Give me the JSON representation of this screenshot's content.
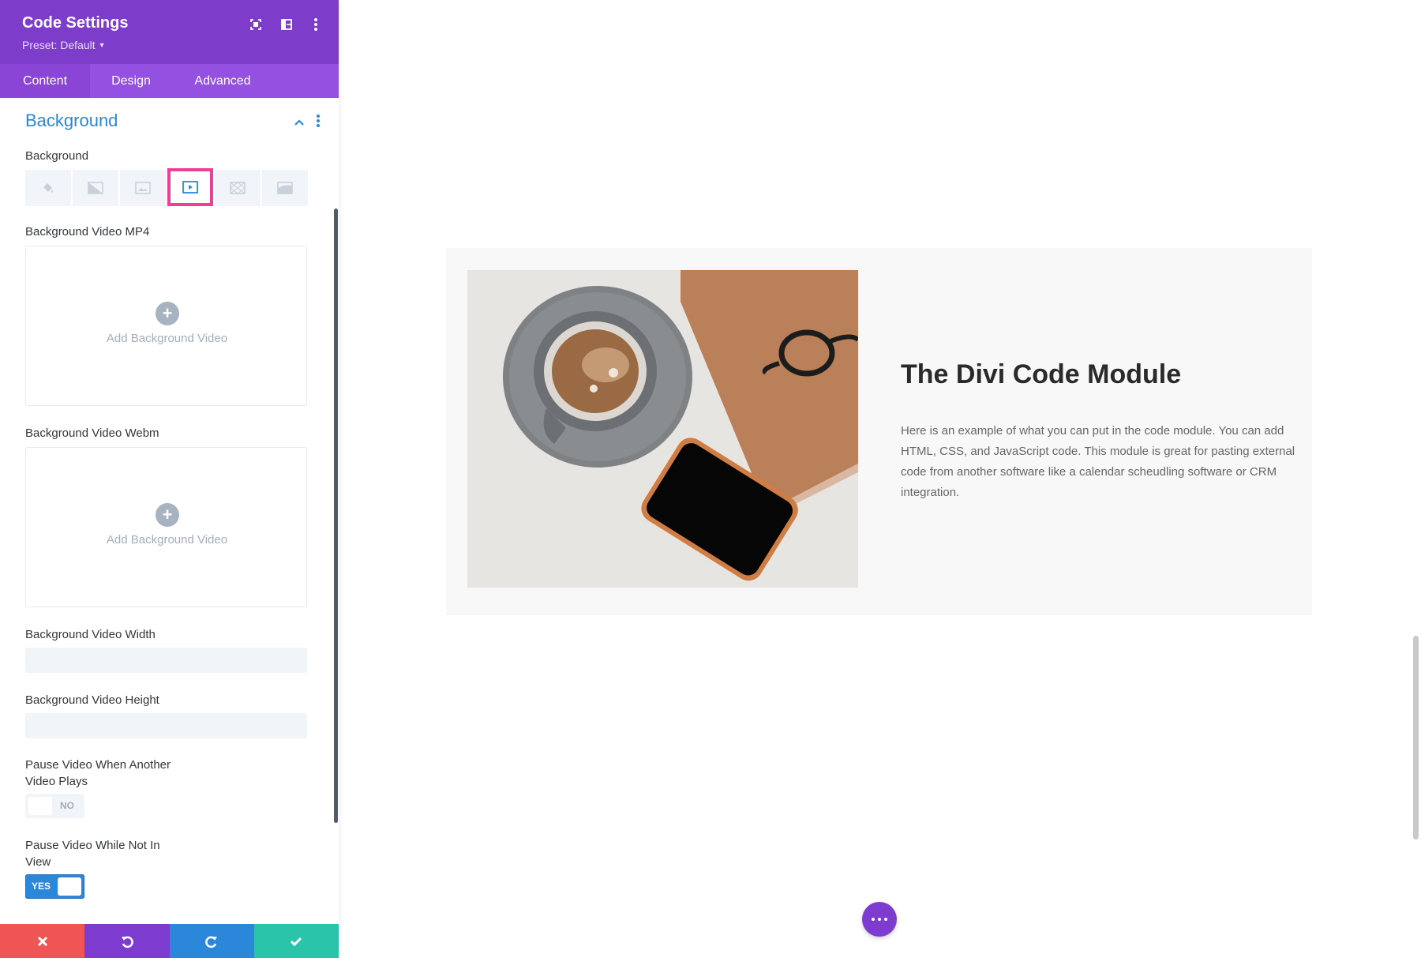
{
  "panel": {
    "title": "Code Settings",
    "preset": "Preset: Default",
    "header_icons": [
      "fullscreen-icon",
      "split-view-icon",
      "more-vertical-icon"
    ],
    "tabs": [
      {
        "label": "Content",
        "active": true
      },
      {
        "label": "Design",
        "active": false
      },
      {
        "label": "Advanced",
        "active": false
      }
    ],
    "section": {
      "title": "Background",
      "expanded": true
    },
    "background_label": "Background",
    "background_types": [
      {
        "name": "color-fill-icon",
        "selected": false
      },
      {
        "name": "gradient-icon",
        "selected": false
      },
      {
        "name": "image-icon",
        "selected": false
      },
      {
        "name": "video-icon",
        "selected": true
      },
      {
        "name": "pattern-icon",
        "selected": false
      },
      {
        "name": "mask-icon",
        "selected": false
      }
    ],
    "video_mp4": {
      "label": "Background Video MP4",
      "button": "Add Background Video"
    },
    "video_webm": {
      "label": "Background Video Webm",
      "button": "Add Background Video"
    },
    "video_width": {
      "label": "Background Video Width",
      "value": ""
    },
    "video_height": {
      "label": "Background Video Height",
      "value": ""
    },
    "pause_other": {
      "label_line1": "Pause Video When Another",
      "label_line2": "Video Plays",
      "state": "NO"
    },
    "pause_not_in_view": {
      "label_line1": "Pause Video While Not In",
      "label_line2": "View",
      "state": "YES"
    },
    "footer": [
      "cancel-icon",
      "undo-icon",
      "redo-icon",
      "save-check-icon"
    ]
  },
  "preview": {
    "module_title": "The Divi Code Module",
    "module_body": "Here is an example of what you can put in the code module. You can add HTML, CSS, and JavaScript code. This module is great for pasting external code from another software like a calendar scheudling software or CRM integration.",
    "image_alt": "coffee-cup-notebook-glasses-phone"
  },
  "colors": {
    "header_purple": "#7d3cca",
    "tab_purple": "#9450e0",
    "accent_blue": "#2b87da",
    "highlight_pink": "#ec3f97",
    "cancel_red": "#ef5555",
    "save_green": "#29c4a9"
  }
}
